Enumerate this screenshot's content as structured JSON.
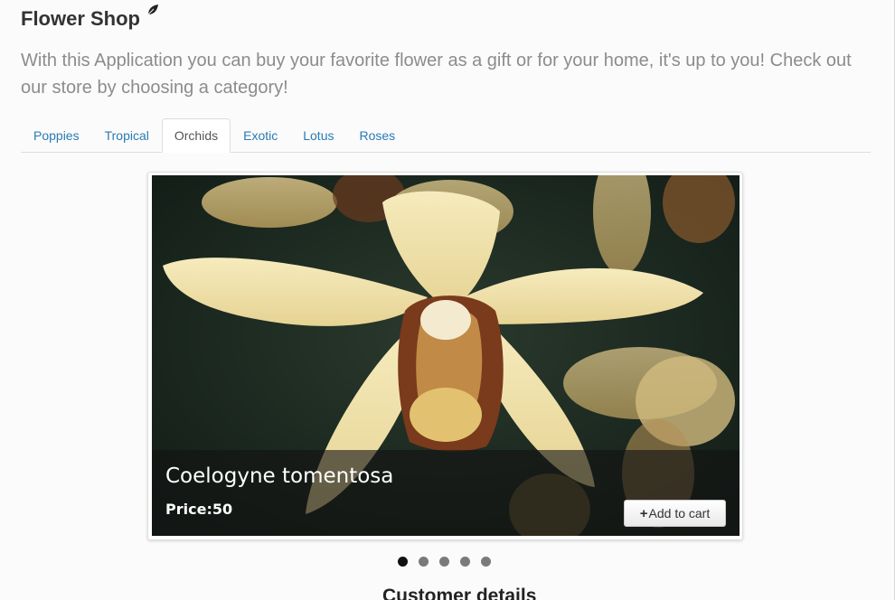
{
  "header": {
    "title": "Flower Shop",
    "icon": "leaf-icon"
  },
  "intro": {
    "text": "With this Application you can buy your favorite flower as a gift or for your home, it's up to you! Check out our store by choosing a category!"
  },
  "tabs": [
    {
      "label": "Poppies",
      "active": false
    },
    {
      "label": "Tropical",
      "active": false
    },
    {
      "label": "Orchids",
      "active": true
    },
    {
      "label": "Exotic",
      "active": false
    },
    {
      "label": "Lotus",
      "active": false
    },
    {
      "label": "Roses",
      "active": false
    }
  ],
  "carousel": {
    "slide": {
      "name": "Coelogyne tomentosa",
      "price": "Price:50",
      "add_to_cart_label": "Add to cart",
      "add_icon": "plus-icon"
    },
    "indicator_count": 5,
    "active_indicator": 1
  },
  "customer": {
    "heading": "Customer details"
  },
  "colors": {
    "link": "#2a7ab5",
    "intro_text": "#8c8c8c",
    "caption_bg": "rgba(20,20,20,0.62)"
  }
}
